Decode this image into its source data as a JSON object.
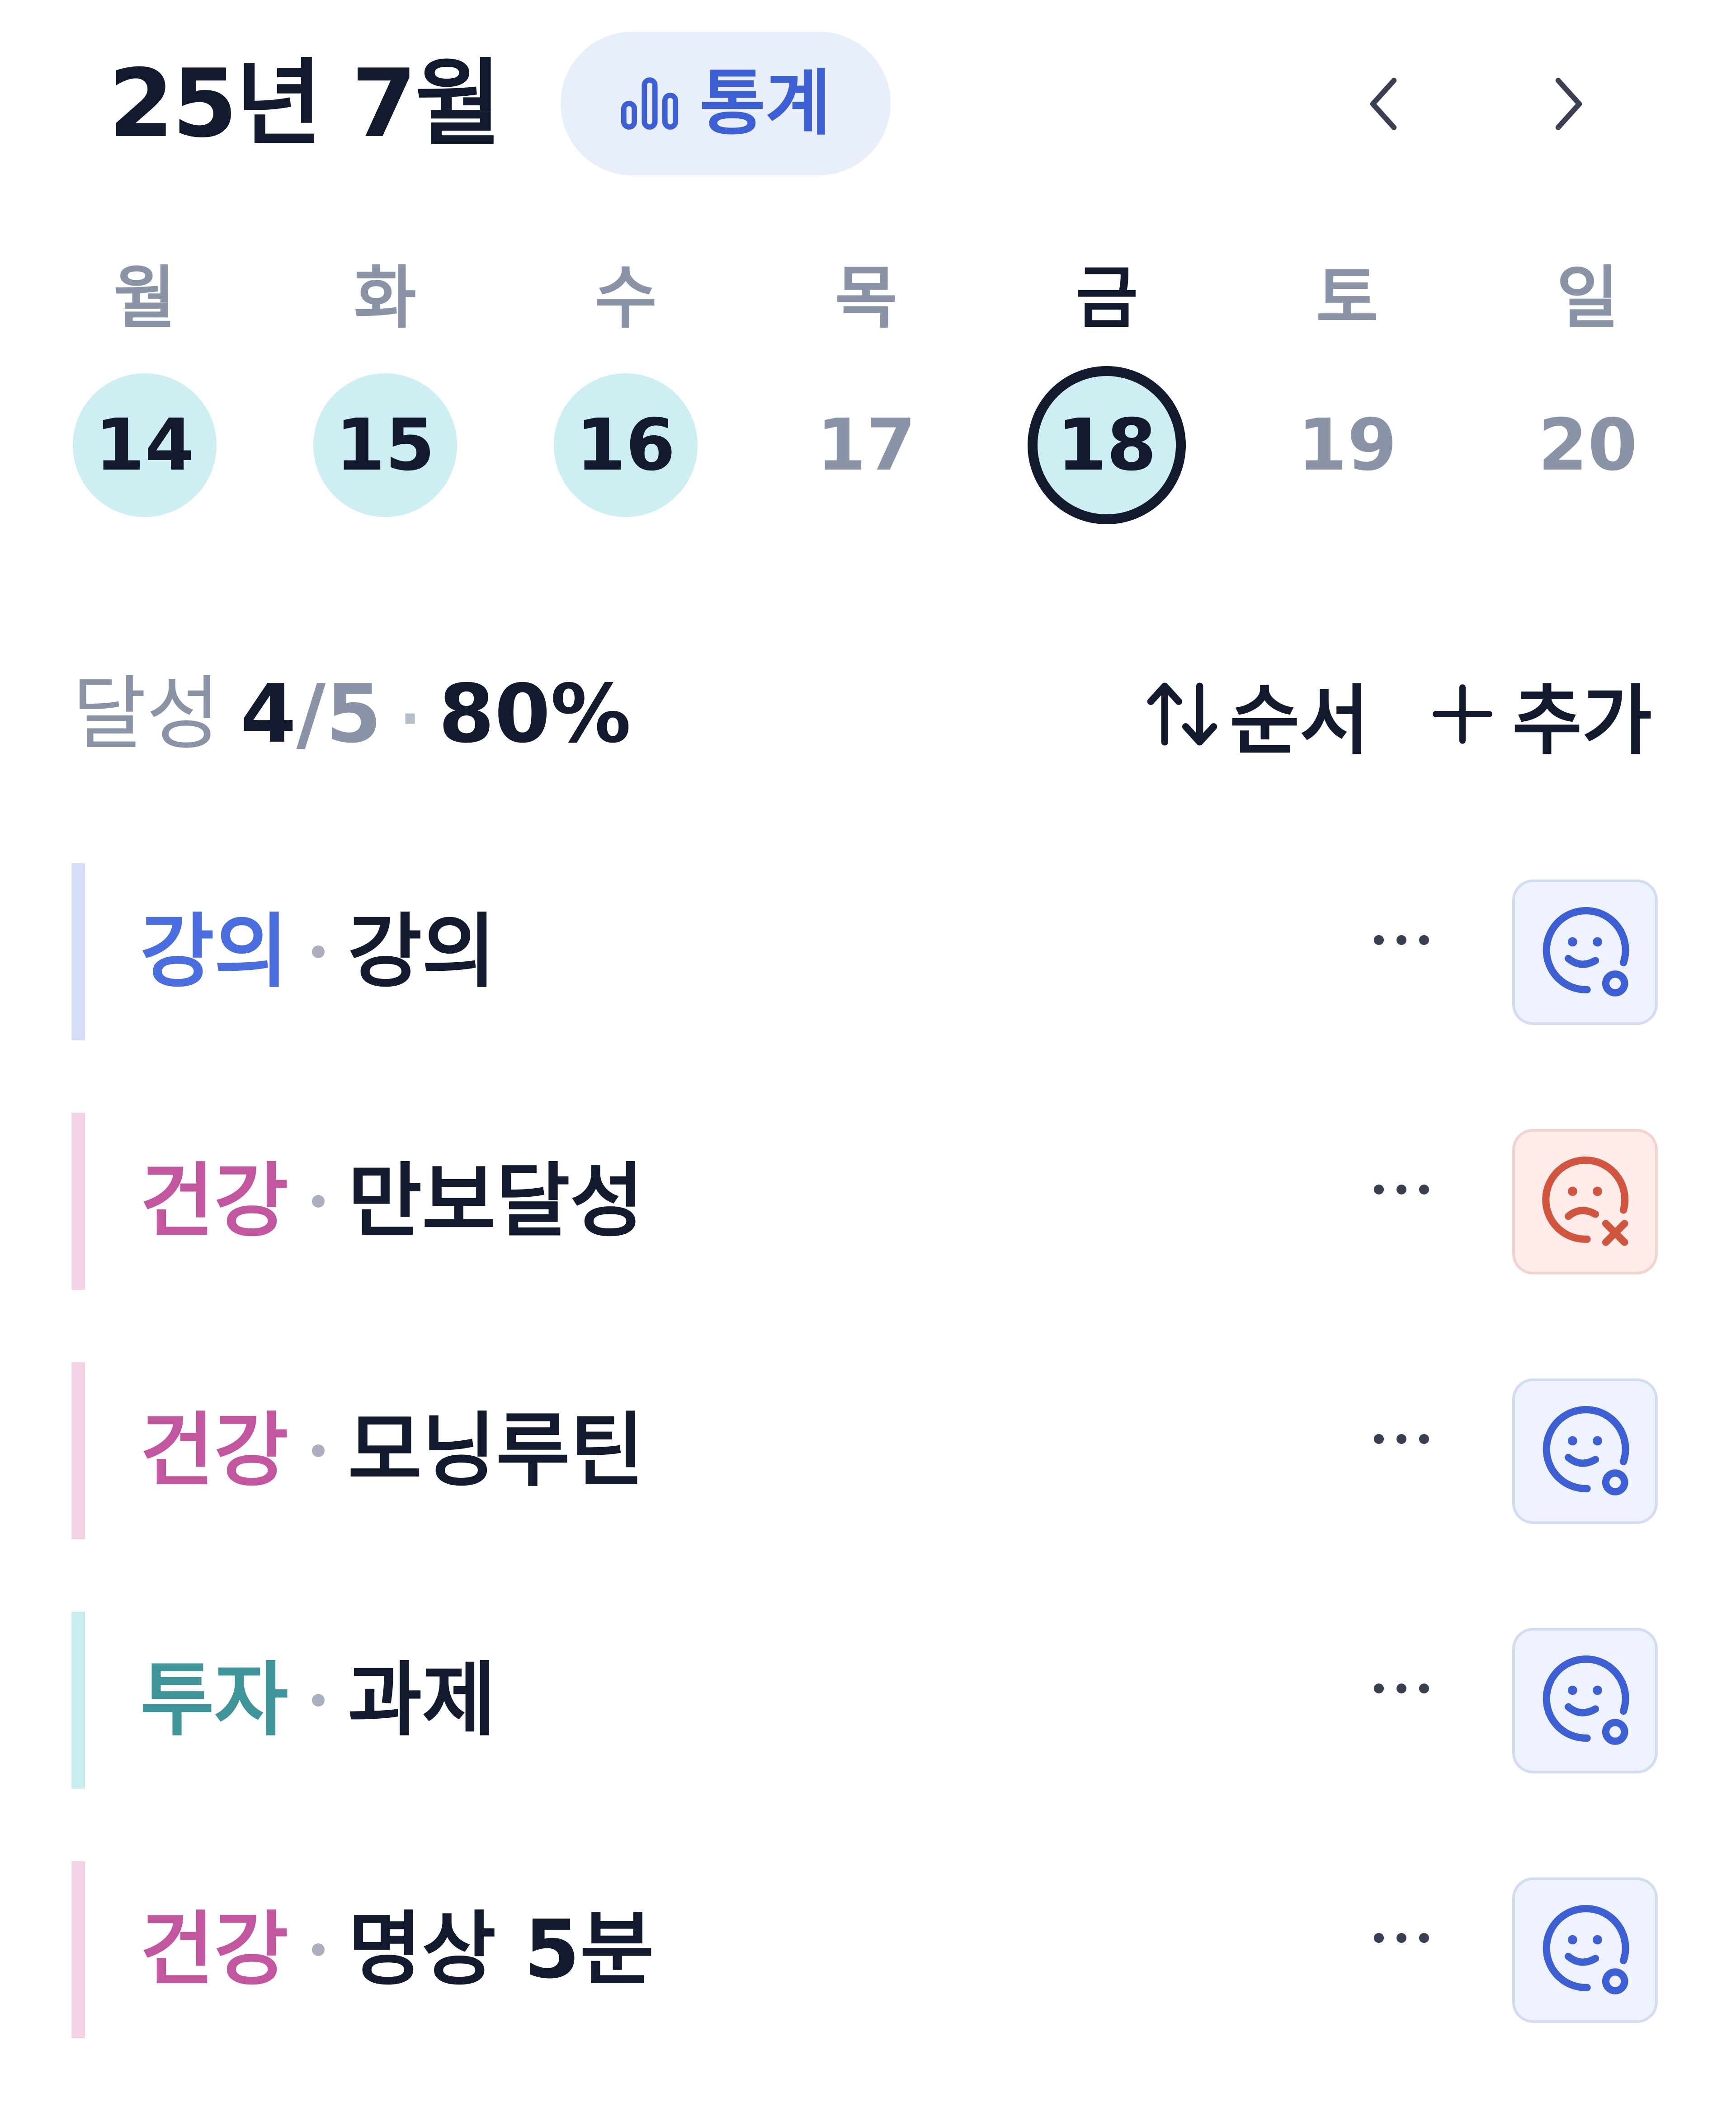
{
  "header": {
    "month_title": "25년 7월",
    "stats_label": "통계",
    "stats_icon": "bar-chart-icon",
    "prev_icon": "chevron-left-icon",
    "next_icon": "chevron-right-icon"
  },
  "week": {
    "weekdays": [
      "월",
      "화",
      "수",
      "목",
      "금",
      "토",
      "일"
    ],
    "days": [
      {
        "date": "14",
        "state": "done"
      },
      {
        "date": "15",
        "state": "done"
      },
      {
        "date": "16",
        "state": "done"
      },
      {
        "date": "17",
        "state": "future"
      },
      {
        "date": "18",
        "state": "today"
      },
      {
        "date": "19",
        "state": "future"
      },
      {
        "date": "20",
        "state": "future"
      }
    ]
  },
  "summary": {
    "label": "달성",
    "done": "4",
    "total": "/5",
    "separator": "·",
    "percent": "80%",
    "order_label": "순서",
    "order_icon": "sort-arrows-icon",
    "add_label": "추가",
    "add_icon": "plus-icon"
  },
  "habits": [
    {
      "category": "강의",
      "name": "강의",
      "status": "done",
      "status_icon": "smile-check-icon"
    },
    {
      "category": "건강",
      "name": "만보달성",
      "status": "failed",
      "status_icon": "sad-x-icon"
    },
    {
      "category": "건강",
      "name": "모닝루틴",
      "status": "done",
      "status_icon": "smile-check-icon"
    },
    {
      "category": "투자",
      "name": "과제",
      "status": "done",
      "status_icon": "smile-check-icon"
    },
    {
      "category": "건강",
      "name": "명상 5분",
      "status": "done",
      "status_icon": "smile-check-icon"
    }
  ],
  "colors": {
    "text_primary": "#141a2e",
    "text_muted": "#8b93a6",
    "accent_blue": "#3d5fd4",
    "stats_bg": "#e9eefb",
    "done_day_bg": "#cdeef2",
    "category_강의": "#4a6ee0",
    "category_강의_bar": "#d5ddf7",
    "category_건강": "#c2579f",
    "category_건강_bar": "#f5d3e6",
    "category_투자": "#3f9599",
    "category_투자_bar": "#c9ecee",
    "status_ok": "#3d5fd4",
    "status_fail": "#d2553f"
  }
}
